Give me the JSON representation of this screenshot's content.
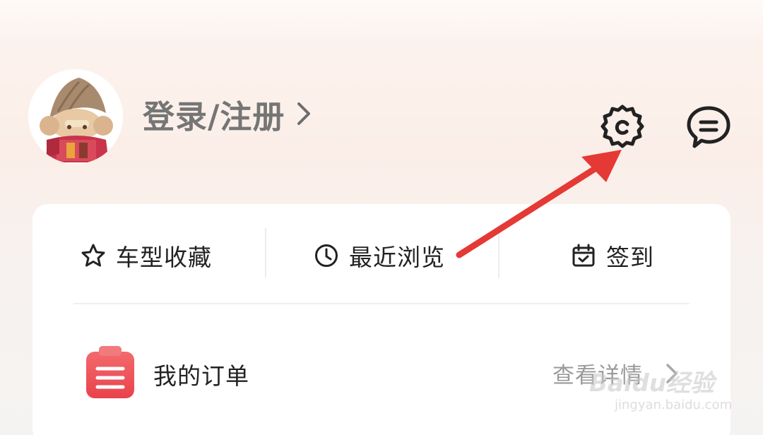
{
  "header": {
    "login_label": "登录/注册"
  },
  "quick_actions": [
    {
      "label": "车型收藏",
      "icon": "star-icon"
    },
    {
      "label": "最近浏览",
      "icon": "clock-icon"
    },
    {
      "label": "签到",
      "icon": "calendar-check-icon"
    }
  ],
  "orders": {
    "label": "我的订单",
    "detail_label": "查看详情",
    "icon": "clipboard-icon"
  },
  "watermark": {
    "brand": "Baidu经验",
    "url": "jingyan.baidu.com"
  },
  "colors": {
    "annotation_arrow": "#e53935",
    "order_icon": "#f0535a",
    "text_primary": "#222222",
    "text_secondary": "#9a9a9a",
    "login_text": "#757575"
  }
}
